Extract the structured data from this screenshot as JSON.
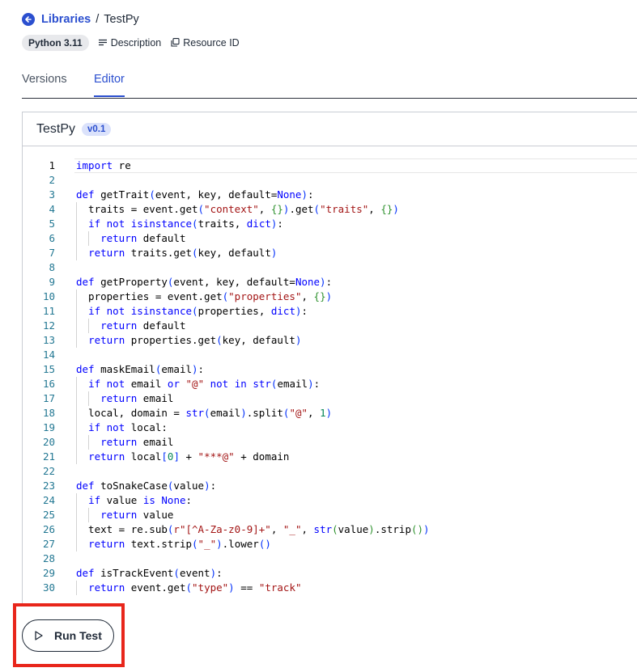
{
  "breadcrumb": {
    "back_icon": "arrow-left-circle-icon",
    "parent": "Libraries",
    "separator": "/",
    "current": "TestPy"
  },
  "meta": {
    "runtime_badge": "Python 3.11",
    "description_label": "Description",
    "resource_id_label": "Resource ID"
  },
  "tabs": [
    {
      "label": "Versions",
      "active": false
    },
    {
      "label": "Editor",
      "active": true
    }
  ],
  "editor": {
    "title": "TestPy",
    "version": "v0.1",
    "active_line": 1,
    "lines": [
      "import re",
      "",
      "def getTrait(event, key, default=None):",
      "  traits = event.get(\"context\", {}).get(\"traits\", {})",
      "  if not isinstance(traits, dict):",
      "    return default",
      "  return traits.get(key, default)",
      "",
      "def getProperty(event, key, default=None):",
      "  properties = event.get(\"properties\", {})",
      "  if not isinstance(properties, dict):",
      "    return default",
      "  return properties.get(key, default)",
      "",
      "def maskEmail(email):",
      "  if not email or \"@\" not in str(email):",
      "    return email",
      "  local, domain = str(email).split(\"@\", 1)",
      "  if not local:",
      "    return email",
      "  return local[0] + \"***@\" + domain",
      "",
      "def toSnakeCase(value):",
      "  if value is None:",
      "    return value",
      "  text = re.sub(r\"[^A-Za-z0-9]+\", \"_\", str(value).strip())",
      "  return text.strip(\"_\").lower()",
      "",
      "def isTrackEvent(event):",
      "  return event.get(\"type\") == \"track\""
    ]
  },
  "run_button": {
    "label": "Run Test",
    "icon": "play-icon"
  },
  "colors": {
    "accent": "#2b4fcf",
    "highlight_box": "#e8261b",
    "keyword": "#0000ff",
    "string": "#a31515",
    "line_number": "#237893"
  }
}
